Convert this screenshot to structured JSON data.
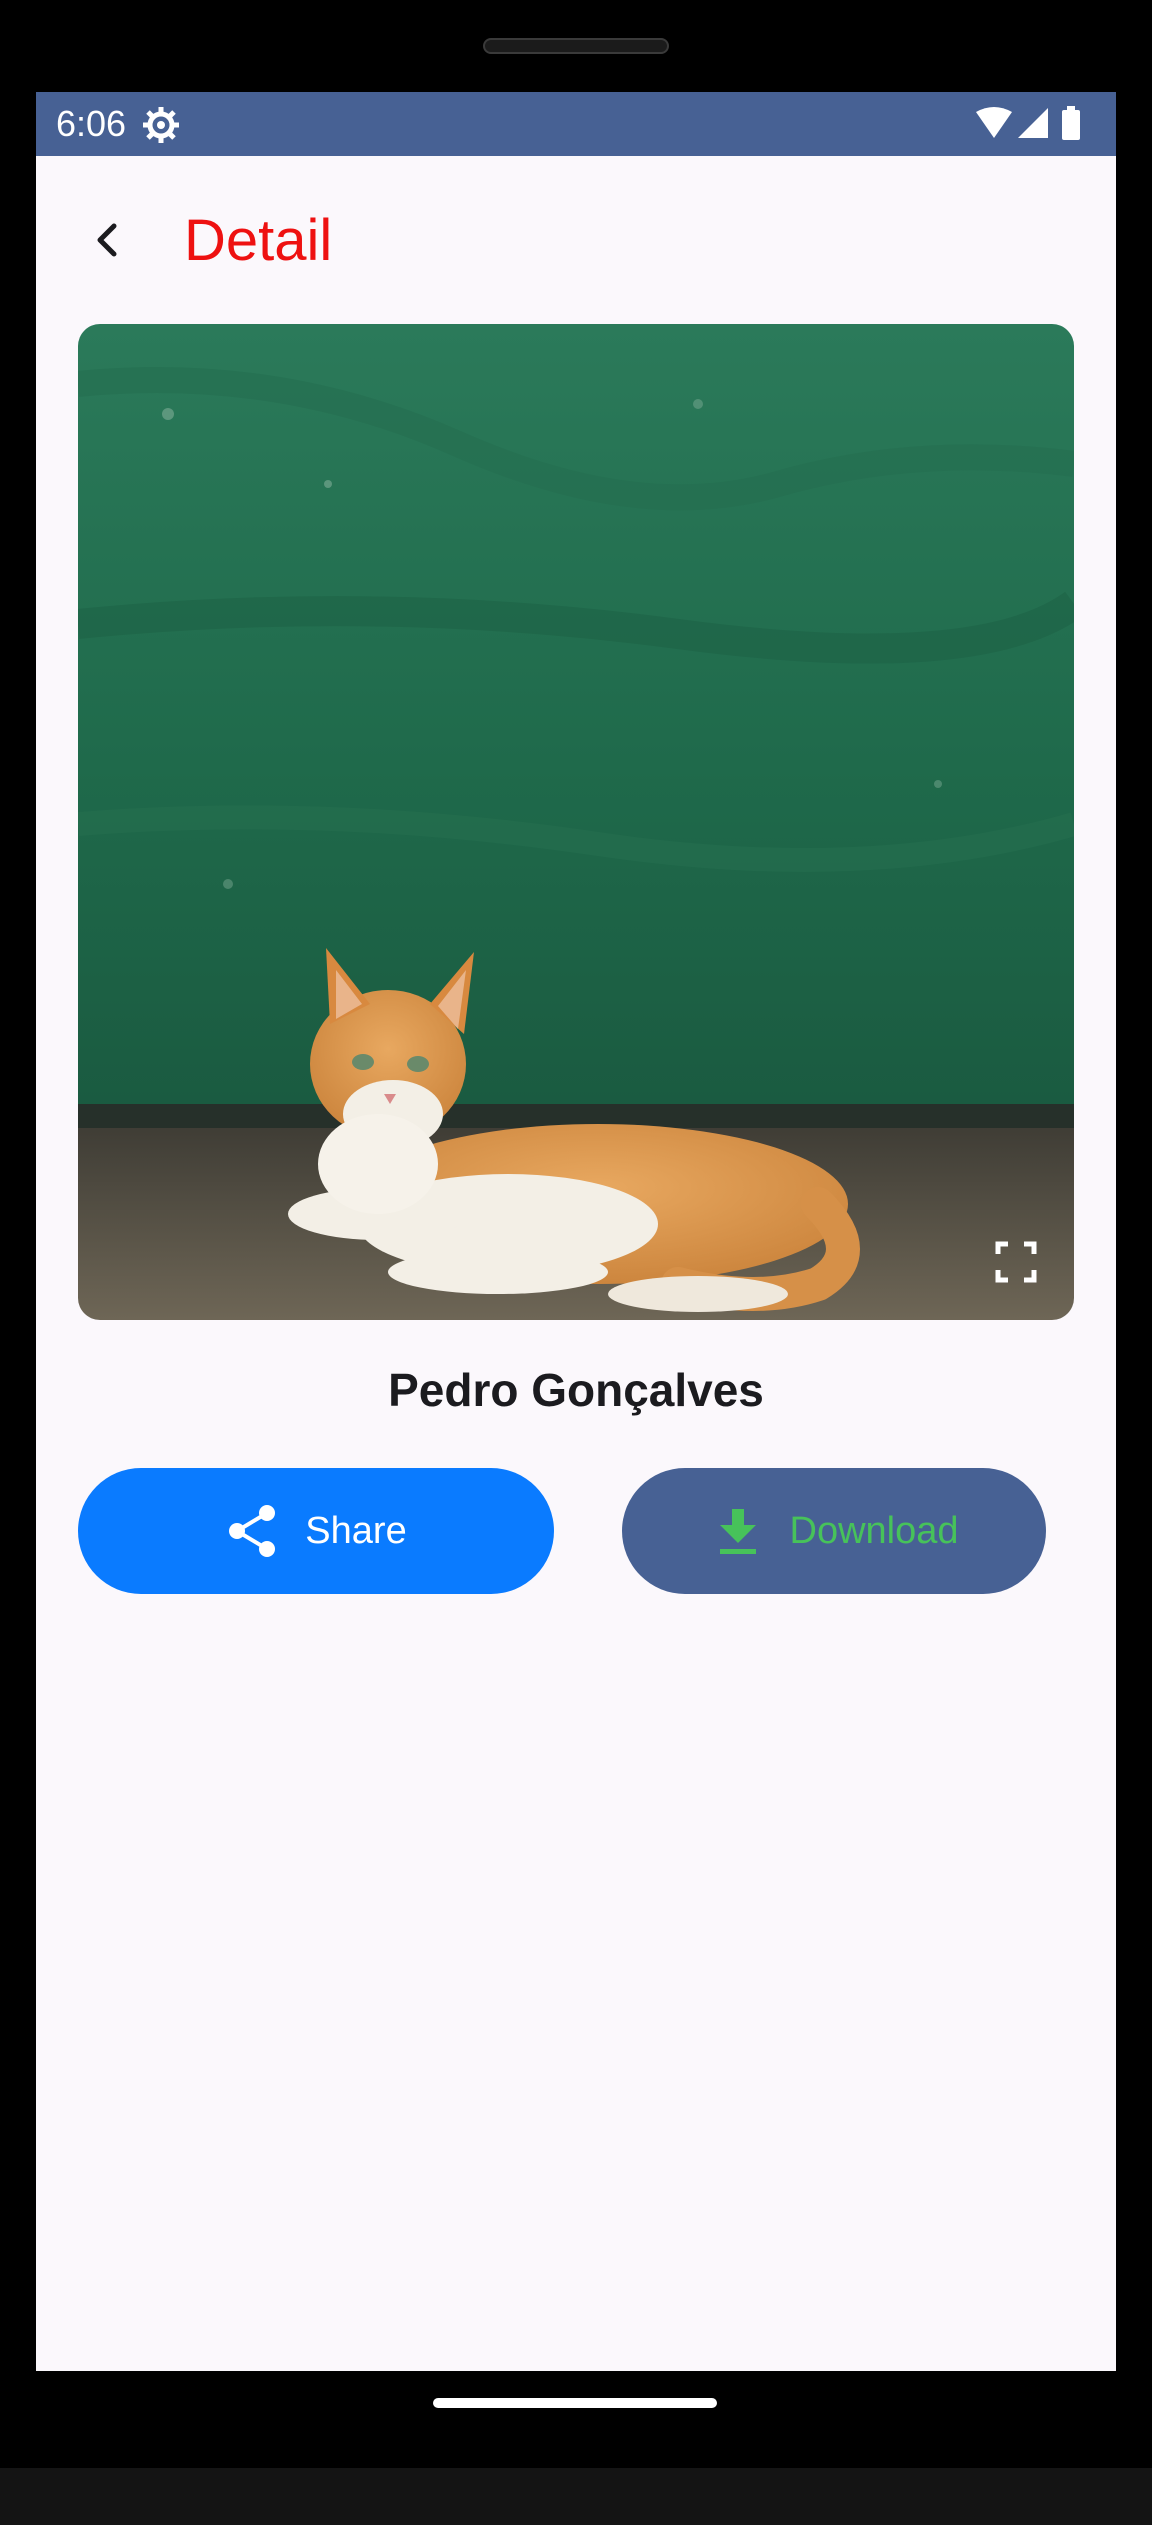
{
  "status_bar": {
    "time": "6:06",
    "icons": [
      "settings-gear-icon",
      "wifi-icon",
      "cell-signal-icon",
      "battery-icon"
    ],
    "background_color": "#476194"
  },
  "app_bar": {
    "back_icon": "chevron-left-icon",
    "title": "Detail",
    "title_color": "#ee1111"
  },
  "photo": {
    "subject": "orange and white cat lying in front of green wall",
    "fullscreen_icon": "fullscreen-icon"
  },
  "author": {
    "name": "Pedro Gonçalves"
  },
  "actions": {
    "share": {
      "label": "Share",
      "icon": "share-icon",
      "background_color": "#0a7bff",
      "text_color": "#ffffff"
    },
    "download": {
      "label": "Download",
      "icon": "download-icon",
      "background_color": "#476194",
      "text_color": "#47c25a"
    }
  }
}
